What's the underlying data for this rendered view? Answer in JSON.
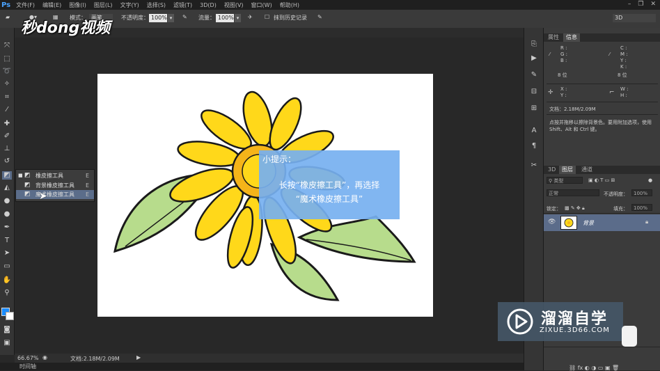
{
  "app": {
    "logo": "Ps"
  },
  "menu": [
    "文件(F)",
    "编辑(E)",
    "图像(I)",
    "图层(L)",
    "文字(Y)",
    "选择(S)",
    "滤镜(T)",
    "3D(D)",
    "视图(V)",
    "窗口(W)",
    "帮助(H)"
  ],
  "options": {
    "mode_label": "模式：",
    "mode_value": "画笔",
    "opacity_label": "不透明度：",
    "opacity_value": "100%",
    "flow_label": "流量：",
    "flow_value": "100%",
    "erase_history_label": "抹到历史记录",
    "workspace_value": "3D"
  },
  "flyout": {
    "items": [
      {
        "label": "橡皮擦工具",
        "shortcut": "E",
        "icon": "eraser-icon",
        "selected": false
      },
      {
        "label": "背景橡皮擦工具",
        "shortcut": "E",
        "icon": "background-eraser-icon",
        "selected": false
      },
      {
        "label": "魔术橡皮擦工具",
        "shortcut": "E",
        "icon": "magic-eraser-icon",
        "selected": true
      }
    ]
  },
  "tip": {
    "title": "小提示：",
    "line1": "长按“橡皮擦工具”，再选择",
    "line2": "“魔术橡皮擦工具”"
  },
  "status": {
    "zoom": "66.67%",
    "doc_info": "文档:2.18M/2.09M",
    "timeline_tab": "时间轴"
  },
  "info_panel": {
    "tabs": [
      "属性",
      "信息"
    ],
    "active_tab": "信息",
    "rgb": [
      "R :",
      "G :",
      "B :"
    ],
    "cmyk": [
      "C :",
      "M :",
      "Y :",
      "K :"
    ],
    "bits_left": "8 位",
    "bits_right": "8 位",
    "xy": [
      "X :",
      "Y :"
    ],
    "wh": [
      "W :",
      "H :"
    ],
    "doc": "文档：2.18M/2.09M",
    "hint": "点按并拖移以擦除背景色。要用附加选项，使用 Shift、Alt 和 Ctrl 键。"
  },
  "layers_panel": {
    "tabs": [
      "3D",
      "图层",
      "通道"
    ],
    "active_tab": "图层",
    "filter_kind": "类型",
    "blend_mode": "正常",
    "opacity_label": "不透明度：",
    "opacity_value": "100%",
    "lock_label": "锁定：",
    "fill_label": "填充：",
    "fill_value": "100%",
    "layer_name": "背景"
  },
  "watermarks": {
    "top_logo": "秒dong视频",
    "brand": "溜溜自学",
    "url": "ZIXUE.3D66.COM"
  }
}
